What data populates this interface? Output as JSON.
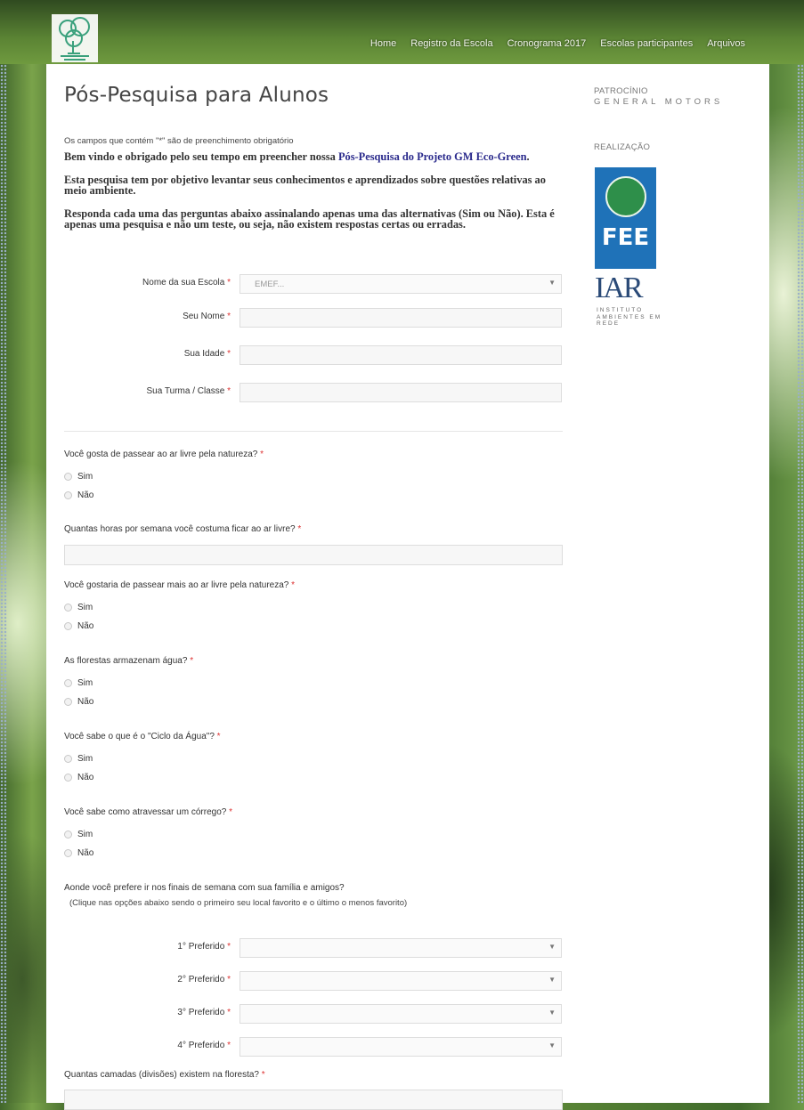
{
  "nav": {
    "items": [
      "Home",
      "Registro da Escola",
      "Cronograma 2017",
      "Escolas participantes",
      "Arquivos"
    ]
  },
  "page": {
    "title": "Pós-Pesquisa para Alunos",
    "required_note": "Os campos que contém \"*\" são de preenchimento obrigatório",
    "intro1_a": "Bem vindo e obrigado pelo seu tempo em preencher nossa ",
    "intro1_link": "Pós-Pesquisa do Projeto GM Eco-Green",
    "intro1_b": ".",
    "intro2": "Esta pesquisa tem por objetivo levantar seus conhecimentos  e aprendizados sobre questões relativas ao meio ambiente.",
    "intro3": "Responda cada uma das perguntas abaixo assinalando apenas uma das alternativas (Sim ou Não). Esta é apenas uma pesquisa e não um teste, ou seja, não existem respostas certas ou erradas."
  },
  "form": {
    "required_mark": "*",
    "school": {
      "label": "Nome da sua Escola",
      "value": "EMEF..."
    },
    "name": {
      "label": "Seu Nome"
    },
    "age": {
      "label": "Sua Idade"
    },
    "class": {
      "label": "Sua Turma / Classe"
    },
    "q1": {
      "text": "Você gosta de passear ao ar livre pela natureza?",
      "options": [
        "Sim",
        "Não"
      ]
    },
    "q2": {
      "text": "Quantas horas por semana você costuma ficar ao ar livre?"
    },
    "q3": {
      "text": "Você gostaria de passear mais ao ar livre pela natureza?",
      "options": [
        "Sim",
        "Não"
      ]
    },
    "q4": {
      "text": "As florestas armazenam água?",
      "options": [
        "Sim",
        "Não"
      ]
    },
    "q5": {
      "text": "Você sabe o que é o \"Ciclo da Água\"?",
      "options": [
        "Sim",
        "Não"
      ]
    },
    "q6": {
      "text": "Você sabe como atravessar um córrego?",
      "options": [
        "Sim",
        "Não"
      ]
    },
    "q7": {
      "text": "Aonde você prefere ir nos finais de semana com sua família e amigos?",
      "hint": "(Clique nas opções abaixo sendo o primeiro seu local favorito e o último o menos favorito)",
      "ranks": [
        "1° Preferido",
        "2° Preferido",
        "3° Preferido",
        "4° Preferido"
      ]
    },
    "q8": {
      "text": "Quantas camadas (divisões) existem na floresta?"
    }
  },
  "sidebar": {
    "sponsor_label": "PATROCÍNIO",
    "sponsor_name": "GENERAL MOTORS",
    "realization_label": "REALIZAÇÃO",
    "fee_text": "FEE",
    "iar_text": "IAR",
    "iar_sub": "INSTITUTO AMBIENTES EM REDE"
  },
  "colors": {
    "link": "#2a2a8c",
    "required": "#dd3333",
    "fee_blue": "#1f72b8"
  }
}
